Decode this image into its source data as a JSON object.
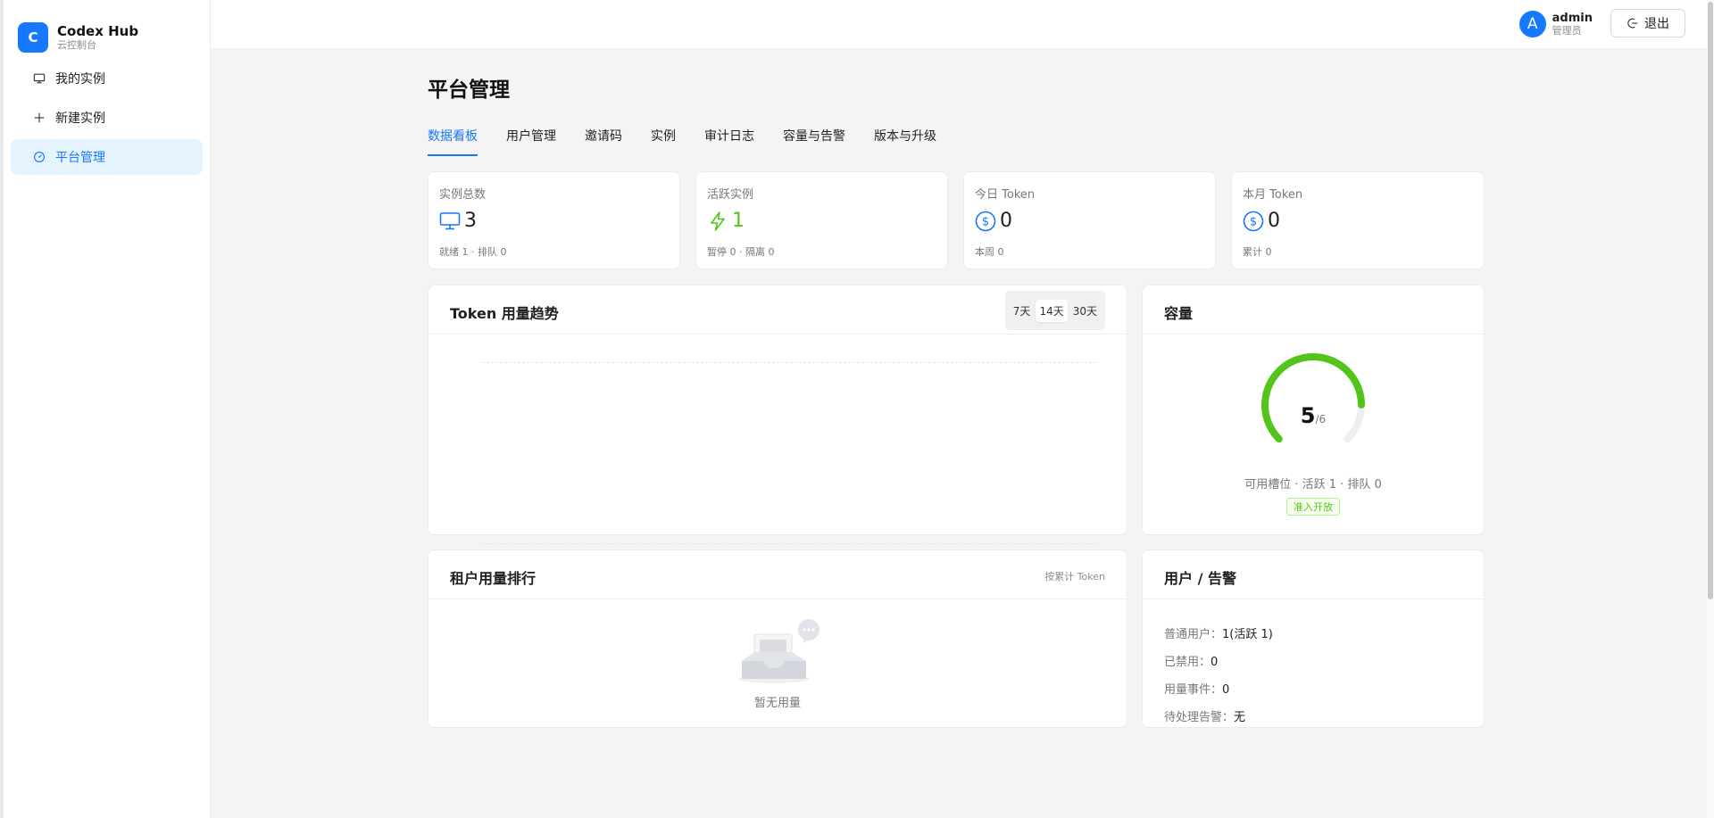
{
  "app": {
    "logo_letter": "C",
    "title": "Codex Hub",
    "subtitle": "云控制台"
  },
  "sidebar": {
    "items": [
      {
        "label": "我的实例",
        "icon": "monitor-icon"
      },
      {
        "label": "新建实例",
        "icon": "plus-icon"
      },
      {
        "label": "平台管理",
        "icon": "dashboard-icon"
      }
    ]
  },
  "header": {
    "avatar_letter": "A",
    "user_name": "admin",
    "user_role": "管理员",
    "logout_label": "退出"
  },
  "page": {
    "title": "平台管理"
  },
  "tabs": [
    {
      "label": "数据看板"
    },
    {
      "label": "用户管理"
    },
    {
      "label": "邀请码"
    },
    {
      "label": "实例"
    },
    {
      "label": "审计日志"
    },
    {
      "label": "容量与告警"
    },
    {
      "label": "版本与升级"
    }
  ],
  "stats": [
    {
      "label": "实例总数",
      "value": "3",
      "sub": "就绪 1 · 排队 0",
      "icon": "monitor-icon"
    },
    {
      "label": "活跃实例",
      "value": "1",
      "sub": "暂停 0 · 隔离 0",
      "icon": "lightning-icon",
      "color": "#52c41a"
    },
    {
      "label": "今日 Token",
      "value": "0",
      "sub": "本周 0",
      "icon": "dollar-icon"
    },
    {
      "label": "本月 Token",
      "value": "0",
      "sub": "累计 0",
      "icon": "dollar-icon"
    }
  ],
  "trend": {
    "title": "Token 用量趋势",
    "ranges": [
      "7天",
      "14天",
      "30天"
    ],
    "selected_range": "14天"
  },
  "capacity": {
    "title": "容量",
    "used": "5",
    "total": "/6",
    "fraction": 0.833,
    "detail": "可用槽位 · 活跃 1 · 排队 0",
    "badge": "准入开放",
    "accent": "#52c41a"
  },
  "ranking": {
    "title": "租户用量排行",
    "hint": "按累计 Token",
    "empty_text": "暂无用量"
  },
  "users_alerts": {
    "title": "用户 / 告警",
    "rows": [
      {
        "label": "普通用户：",
        "value": "1(活跃 1)"
      },
      {
        "label": "已禁用：",
        "value": "0"
      },
      {
        "label": "用量事件：",
        "value": "0"
      },
      {
        "label": "待处理告警：",
        "value": "无"
      }
    ]
  },
  "colors": {
    "primary": "#1677ff",
    "success": "#52c41a"
  }
}
